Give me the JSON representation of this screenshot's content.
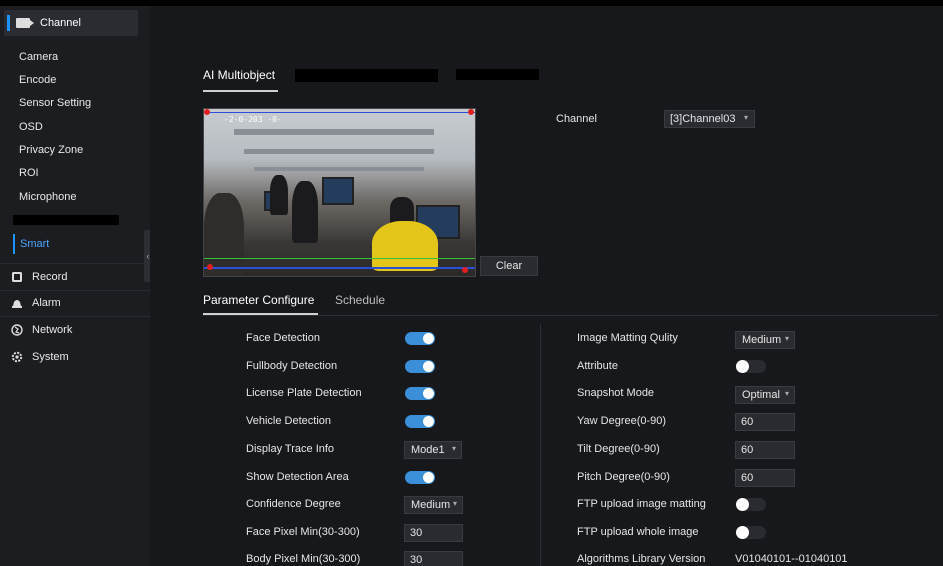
{
  "sidebar": {
    "header": {
      "label": "Channel",
      "icon": "camera-icon"
    },
    "sub_items": [
      {
        "label": "Camera"
      },
      {
        "label": "Encode"
      },
      {
        "label": "Sensor Setting"
      },
      {
        "label": "OSD"
      },
      {
        "label": "Privacy Zone"
      },
      {
        "label": "ROI"
      },
      {
        "label": "Microphone"
      }
    ],
    "smart": {
      "label": "Smart"
    },
    "main_items": [
      {
        "label": "Record",
        "icon": "record-icon"
      },
      {
        "label": "Alarm",
        "icon": "alarm-icon"
      },
      {
        "label": "Network",
        "icon": "globe-icon"
      },
      {
        "label": "System",
        "icon": "gear-icon"
      }
    ]
  },
  "page": {
    "active_tab": "AI Multiobject"
  },
  "video": {
    "overlay_text": "-2-0-203 -0-"
  },
  "clear_button": "Clear",
  "channel": {
    "label": "Channel",
    "value": "[3]Channel03"
  },
  "tabs": {
    "parameter": "Parameter Configure",
    "schedule": "Schedule"
  },
  "left_params": [
    {
      "label": "Face Detection",
      "type": "toggle",
      "on": true
    },
    {
      "label": "Fullbody Detection",
      "type": "toggle",
      "on": true
    },
    {
      "label": "License Plate Detection",
      "type": "toggle",
      "on": true
    },
    {
      "label": "Vehicle Detection",
      "type": "toggle",
      "on": true
    },
    {
      "label": "Display Trace Info",
      "type": "select",
      "value": "Mode1"
    },
    {
      "label": "Show Detection Area",
      "type": "toggle",
      "on": true
    },
    {
      "label": "Confidence Degree",
      "type": "select",
      "value": "Medium"
    },
    {
      "label": "Face Pixel Min(30-300)",
      "type": "input",
      "value": "30"
    },
    {
      "label": "Body Pixel Min(30-300)",
      "type": "input",
      "value": "30"
    }
  ],
  "right_params": [
    {
      "label": "Image Matting Qulity",
      "type": "select",
      "value": "Medium"
    },
    {
      "label": "Attribute",
      "type": "toggle",
      "on": false
    },
    {
      "label": "Snapshot Mode",
      "type": "select",
      "value": "Optimal"
    },
    {
      "label": "Yaw Degree(0-90)",
      "type": "input",
      "value": "60"
    },
    {
      "label": "Tilt Degree(0-90)",
      "type": "input",
      "value": "60"
    },
    {
      "label": "Pitch Degree(0-90)",
      "type": "input",
      "value": "60"
    },
    {
      "label": "FTP upload image matting",
      "type": "toggle",
      "on": false
    },
    {
      "label": "FTP upload whole image",
      "type": "toggle",
      "on": false
    },
    {
      "label": "Algorithms Library Version",
      "type": "text",
      "value": "V01040101--01040101"
    }
  ],
  "colors": {
    "accent": "#3a8fd8",
    "sidebar_bg": "#1c1d21",
    "main_bg": "#17181c"
  }
}
